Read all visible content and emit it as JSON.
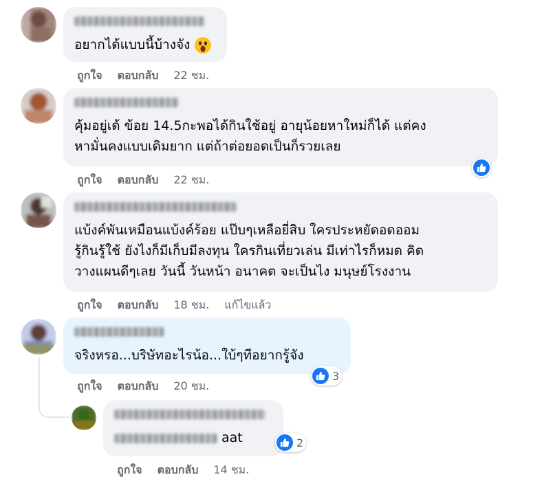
{
  "comments": [
    {
      "text": "อยากได้แบบนี้บ้างจัง",
      "emoji": "face-with-open-mouth-emoji",
      "actions": {
        "like": "ถูกใจ",
        "reply": "ตอบกลับ",
        "time": "22 ชม."
      }
    },
    {
      "text": "คุ้มอยู่เด้ ข้อย 14.5กะพอได้กินใช้อยู่ อายุน้อยหาใหม่ก็ได้ แต่คง\nหามั่นคงแบบเดิมยาก แต่ถ้าต่อยอดเป็นก็รวยเลย",
      "reaction": {
        "icon": "like-icon"
      },
      "actions": {
        "like": "ถูกใจ",
        "reply": "ตอบกลับ",
        "time": "22 ชม."
      }
    },
    {
      "text": "แบ้งค์พันเหมือนแบ้งค์ร้อย แป๊บๆเหลือยี่สิบ ใครประหยัดอดออม\nรู้กินรู้ใช้ ยังไงก็มีเก็บมีลงทุน ใครกินเที่ยวเล่น มีเท่าไรก็หมด คิด\nวางแผนดีๆเลย วันนี้ วันหน้า อนาคต จะเป็นไง มนุษย์โรงงาน",
      "actions": {
        "like": "ถูกใจ",
        "reply": "ตอบกลับ",
        "time": "18 ชม.",
        "edited": "แก้ไขแล้ว"
      }
    },
    {
      "text": "จริงหรอ...บริษัทอะไรน้อ...ใบ้ๆทีอยากรู้จัง",
      "reaction": {
        "icon": "like-icon",
        "count": "3"
      },
      "actions": {
        "like": "ถูกใจ",
        "reply": "ตอบกลับ",
        "time": "20 ชม."
      }
    }
  ],
  "reply": {
    "text": "aat",
    "reaction": {
      "icon": "like-icon",
      "count": "2"
    },
    "actions": {
      "like": "ถูกใจ",
      "reply": "ตอบกลับ",
      "time": "14 ชม."
    }
  },
  "colors": {
    "like_blue": "#1877f2",
    "bubble": "#f0f2f5",
    "highlight_bubble": "#e7f3ff",
    "meta_gray": "#65676b"
  }
}
